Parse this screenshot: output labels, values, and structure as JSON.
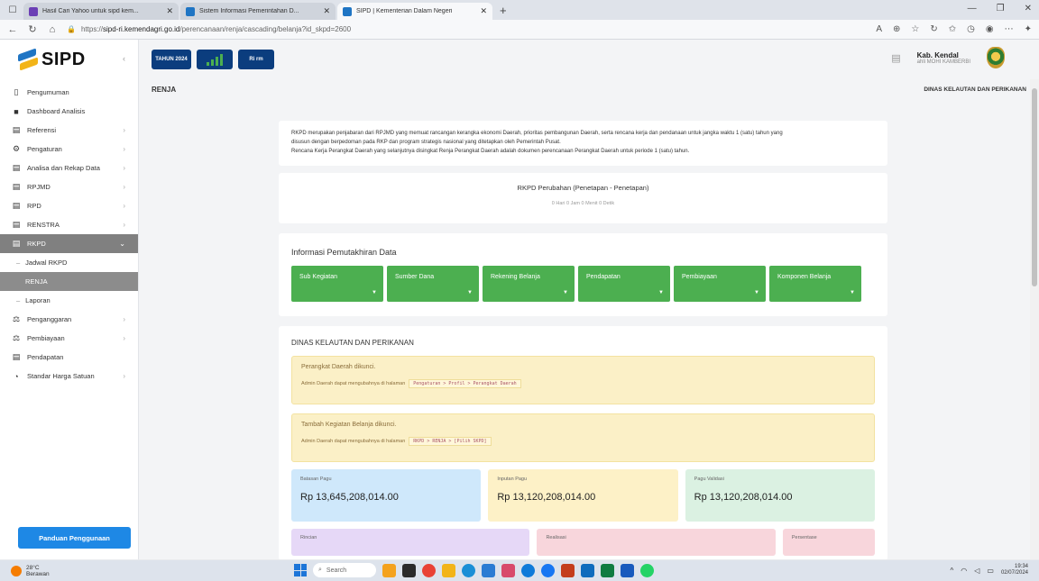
{
  "browser": {
    "tabs": [
      {
        "title": "Hasil Cari Yahoo untuk sipd kem...",
        "color": "#6b3fb5"
      },
      {
        "title": "Sistem Informasi Pemerintahan D...",
        "color": "#1f75c4"
      },
      {
        "title": "SIPD | Kementerian Dalam Negeri",
        "color": "#1f75c4"
      }
    ],
    "new_tab": "+",
    "url_prefix": "https://",
    "url_host": "sipd-ri.kemendagri.go.id",
    "url_path": "/perencanaan/renja/cascading/belanja?id_skpd=2600"
  },
  "app": {
    "logo": "SIPD",
    "topbar": {
      "year": "TAHUN 2024",
      "role": "Ri rm"
    },
    "user": {
      "name": "Kab. Kendal",
      "sub": "ahli MOHI KAMBERBI"
    },
    "page_title": "RENJA",
    "department": "DINAS KELAUTAN DAN PERIKANAN",
    "sidebar": {
      "items": [
        {
          "label": "Pengumuman",
          "icon": "▯"
        },
        {
          "label": "Dashboard Analisis",
          "icon": "■"
        },
        {
          "label": "Referensi",
          "icon": "▤"
        },
        {
          "label": "Pengaturan",
          "icon": "⚙"
        },
        {
          "label": "Analisa dan Rekap Data",
          "icon": "▤"
        },
        {
          "label": "RPJMD",
          "icon": "▤"
        },
        {
          "label": "RPD",
          "icon": "▤"
        },
        {
          "label": "RENSTRA",
          "icon": "▤"
        },
        {
          "label": "RKPD",
          "icon": "▤"
        }
      ],
      "sub_items": [
        {
          "label": "Jadwal RKPD"
        },
        {
          "label": "RENJA"
        },
        {
          "label": "Laporan"
        }
      ],
      "items2": [
        {
          "label": "Penganggaran",
          "icon": "⚖"
        },
        {
          "label": "Pembiayaan",
          "icon": "⚖"
        },
        {
          "label": "Pendapatan",
          "icon": "▤"
        },
        {
          "label": "Standar Harga Satuan",
          "icon": "◔"
        }
      ],
      "guide_button": "Panduan Penggunaan"
    },
    "intro_text": {
      "line1": "RKPD merupakan penjabaran dari RPJMD yang memuat rancangan kerangka ekonomi Daerah, prioritas pembangunan Daerah, serta rencana kerja dan pendanaan untuk jangka waktu 1 (satu) tahun yang",
      "line2": "disusun dengan berpedoman pada RKP dan program strategis nasional yang ditetapkan oleh Pemerintah Pusat.",
      "line3": "Rencana Kerja Perangkat Daerah yang selanjutnya disingkat Renja Perangkat Daerah adalah dokumen perencanaan Perangkat Daerah untuk periode 1 (satu) tahun."
    },
    "rkpd": {
      "title": "RKPD Perubahan (Penetapan - Penetapan)",
      "sub": "0 Hari 0 Jam 0 Menit 0 Detik"
    },
    "update": {
      "heading": "Informasi Pemutakhiran Data",
      "tiles": [
        {
          "label": "Sub Kegiatan"
        },
        {
          "label": "Sumber Dana"
        },
        {
          "label": "Rekening Belanja"
        },
        {
          "label": "Pendapatan"
        },
        {
          "label": "Pembiayaan"
        },
        {
          "label": "Komponen Belanja"
        }
      ]
    },
    "dept_card": {
      "heading": "DINAS KELAUTAN DAN PERIKANAN",
      "alert1": {
        "title": "Perangkat Daerah dikunci.",
        "text": "Admin Daerah dapat mengubahnya di halaman",
        "code": "Pengaturan > Profil > Perangkat Daerah"
      },
      "alert2": {
        "title": "Tambah Kegiatan Belanja dikunci.",
        "text": "Admin Daerah dapat mengubahnya di halaman",
        "code": "RKPD > RENJA > [Pilih SKPD]"
      },
      "stats": [
        {
          "label": "Batasan Pagu",
          "value": "Rp 13,645,208,014.00"
        },
        {
          "label": "Inputan Pagu",
          "value": "Rp 13,120,208,014.00"
        },
        {
          "label": "Pagu Validasi",
          "value": "Rp 13,120,208,014.00"
        }
      ],
      "stats2": [
        {
          "label": "Rincian"
        },
        {
          "label": "Realisasi"
        },
        {
          "label": "Persentase"
        }
      ]
    }
  },
  "taskbar": {
    "weather": {
      "temp": "28°C",
      "desc": "Berawan"
    },
    "search": "Search",
    "time": "19:34",
    "date": "02/07/2024"
  }
}
